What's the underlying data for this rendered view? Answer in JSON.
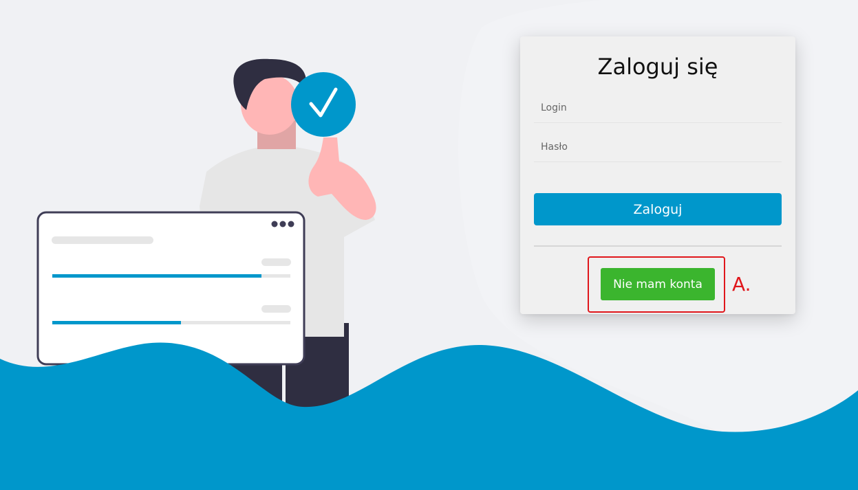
{
  "login_form": {
    "title": "Zaloguj się",
    "login_placeholder": "Login",
    "password_placeholder": "Hasło",
    "submit_label": "Zaloguj",
    "register_label": "Nie mam konta"
  },
  "annotation": {
    "label": "A."
  },
  "colors": {
    "background": "#f0f1f4",
    "brand_blue": "#0097cb",
    "register_green": "#3bb52e",
    "annotation_red": "#e0161b"
  },
  "illustration": {
    "icons": [
      "person-illustration",
      "checkmark-badge-icon",
      "dots-menu-icon",
      "wave-shape"
    ],
    "progress_bars": [
      0.88,
      0.54
    ]
  }
}
